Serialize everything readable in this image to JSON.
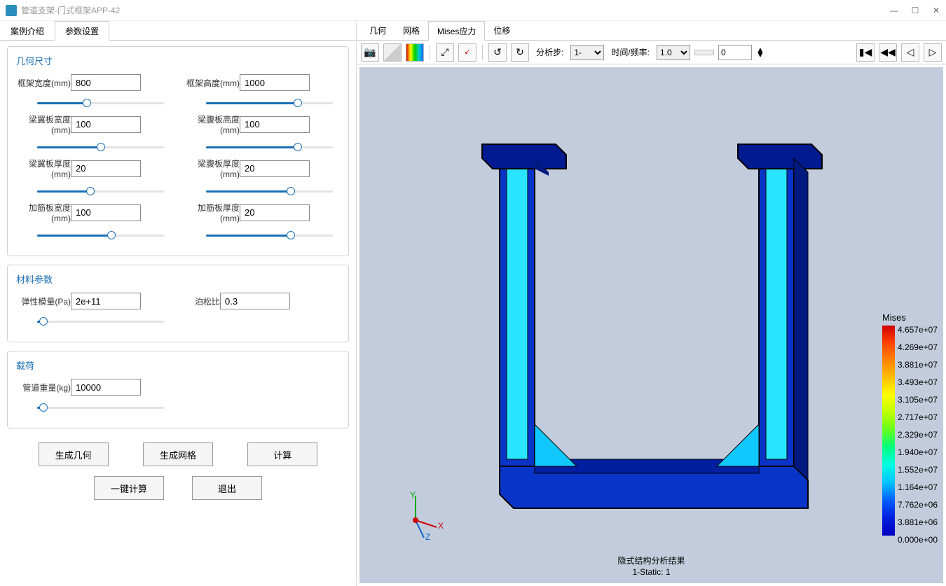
{
  "window": {
    "title": "管道支架-门式框架APP-42"
  },
  "left_tabs": {
    "t1": "案例介绍",
    "t2": "参数设置"
  },
  "sections": {
    "geom": {
      "title": "几何尺寸",
      "frame_w": {
        "label": "框架宽度(mm)",
        "value": "800"
      },
      "frame_h": {
        "label": "框架高度(mm)",
        "value": "1000"
      },
      "flange_w": {
        "label": "梁翼板宽度(mm)",
        "value": "100"
      },
      "web_h": {
        "label": "梁腹板高度(mm)",
        "value": "100"
      },
      "flange_t": {
        "label": "梁翼板厚度(mm)",
        "value": "20"
      },
      "web_t": {
        "label": "梁腹板厚度(mm)",
        "value": "20"
      },
      "rib_w": {
        "label": "加筋板宽度(mm)",
        "value": "100"
      },
      "rib_t": {
        "label": "加筋板厚度(mm)",
        "value": "20"
      }
    },
    "mat": {
      "title": "材料参数",
      "E": {
        "label": "弹性模量(Pa)",
        "value": "2e+11"
      },
      "nu": {
        "label": "泊松比",
        "value": "0.3"
      }
    },
    "load": {
      "title": "载荷",
      "mass": {
        "label": "管道重量(kg)",
        "value": "10000"
      }
    }
  },
  "buttons": {
    "gen_geom": "生成几何",
    "gen_mesh": "生成网格",
    "calc": "计算",
    "one_click": "一键计算",
    "exit": "退出"
  },
  "right_tabs": {
    "geom": "几何",
    "mesh": "网格",
    "mises": "Mises应力",
    "disp": "位移"
  },
  "toolbar": {
    "step_label": "分析步:",
    "step_value": "1-",
    "time_label": "时间/频率:",
    "time_value": "1.0",
    "frame_value": "0"
  },
  "legend": {
    "title": "Mises",
    "ticks": [
      "4.657e+07",
      "4.269e+07",
      "3.881e+07",
      "3.493e+07",
      "3.105e+07",
      "2.717e+07",
      "2.329e+07",
      "1.940e+07",
      "1.552e+07",
      "1.164e+07",
      "7.762e+06",
      "3.881e+06",
      "0.000e+00"
    ]
  },
  "footer": {
    "line1": "隐式结构分析结果",
    "line2": "1-Static: 1"
  },
  "axis": {
    "x": "X",
    "y": "Y",
    "z": "Z"
  }
}
